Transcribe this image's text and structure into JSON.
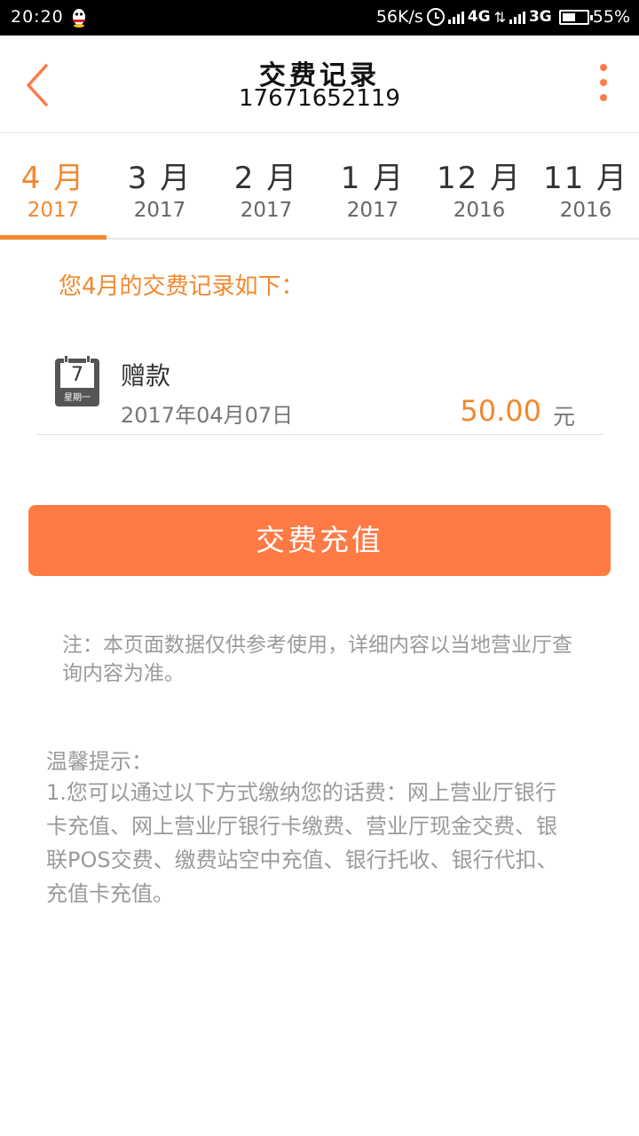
{
  "status_bar": {
    "time": "20:20",
    "net_speed": "56K/s",
    "network1": "4G",
    "network2": "3G",
    "battery": "55%",
    "battery_level": 0.55
  },
  "header": {
    "title": "交费记录",
    "phone": "17671652119"
  },
  "tabs": [
    {
      "month": "4 月",
      "year": "2017",
      "active": true
    },
    {
      "month": "3 月",
      "year": "2017"
    },
    {
      "month": "2 月",
      "year": "2017"
    },
    {
      "month": "1 月",
      "year": "2017"
    },
    {
      "month": "12 月",
      "year": "2016"
    },
    {
      "month": "11 月",
      "year": "2016"
    }
  ],
  "intro": "您4月的交费记录如下：",
  "record": {
    "calendar_day": "7",
    "calendar_weekday": "星期一",
    "type": "赠款",
    "date": "2017年04月07日",
    "amount": "50.00",
    "unit": "元"
  },
  "recharge_button": "交费充值",
  "note": "注：本页面数据仅供参考使用，详细内容以当地营业厅查询内容为准。",
  "tips": {
    "heading": "温馨提示：",
    "body": "1.您可以通过以下方式缴纳您的话费：网上营业厅银行卡充值、网上营业厅银行卡缴费、营业厅现金交费、银联POS交费、缴费站空中充值、银行托收、银行代扣、充值卡充值。"
  },
  "colors": {
    "accent": "#f3882d",
    "button": "#ff7a45",
    "muted": "#9a9a9a"
  }
}
